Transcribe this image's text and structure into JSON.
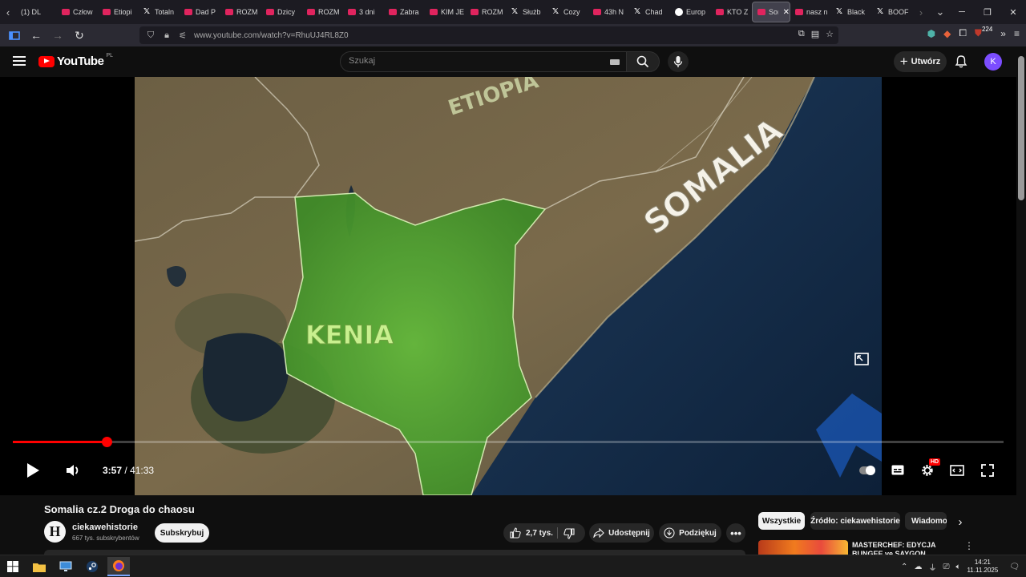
{
  "browser": {
    "tabs": [
      {
        "label": "(1) DL",
        "icon": "none"
      },
      {
        "label": "Człow",
        "icon": "youtube"
      },
      {
        "label": "Etiopi",
        "icon": "youtube"
      },
      {
        "label": "Totaln",
        "icon": "x"
      },
      {
        "label": "Dad P",
        "icon": "youtube"
      },
      {
        "label": "ROZM",
        "icon": "youtube"
      },
      {
        "label": "Dzicy",
        "icon": "youtube"
      },
      {
        "label": "ROZM",
        "icon": "youtube"
      },
      {
        "label": "3 dni",
        "icon": "youtube"
      },
      {
        "label": "Zabra",
        "icon": "youtube"
      },
      {
        "label": "KIM JE",
        "icon": "youtube"
      },
      {
        "label": "ROZM",
        "icon": "youtube"
      },
      {
        "label": "Służb",
        "icon": "x"
      },
      {
        "label": "Cozy",
        "icon": "x"
      },
      {
        "label": "43h N",
        "icon": "youtube"
      },
      {
        "label": "Chad",
        "icon": "x"
      },
      {
        "label": "Europ",
        "icon": "globe"
      },
      {
        "label": "KTO Z",
        "icon": "youtube"
      },
      {
        "label": "Son",
        "icon": "youtube",
        "active": true
      },
      {
        "label": "nasz n",
        "icon": "youtube"
      },
      {
        "label": "Black",
        "icon": "x"
      },
      {
        "label": "BOOF",
        "icon": "x"
      }
    ],
    "url": "www.youtube.com/watch?v=RhuUJ4RL8Z0",
    "ext_badge": "224"
  },
  "youtube": {
    "logo_text": "YouTube",
    "country": "PL",
    "search_placeholder": "Szukaj",
    "create_label": "Utwórz",
    "avatar_letter": "K"
  },
  "player": {
    "current_time": "3:57",
    "separator": "/",
    "duration": "41:33",
    "progress": 0.095,
    "hd_label": "HD",
    "map_labels": {
      "kenya": "KENIA",
      "somalia": "SOMALIA",
      "ethiopia": "ETIOPIA"
    }
  },
  "video": {
    "title": "Somalia cz.2 Droga do chaosu",
    "channel_letter": "H",
    "channel_name": "ciekawehistorie",
    "subscribers": "667 tys. subskrybentów",
    "subscribe_label": "Subskrybuj",
    "likes": "2,7 tys.",
    "share_label": "Udostępnij",
    "thanks_label": "Podziękuj"
  },
  "chips": [
    "Wszystkie",
    "Źródło: ciekawehistorie",
    "Wiadomości"
  ],
  "recommendation": {
    "title": "MASTERCHEF: EDYCJA BUNGEE ve SAYGON"
  },
  "taskbar": {
    "time": "14:21",
    "date": "11.11.2025"
  },
  "colors": {
    "accent_red": "#ff0000",
    "avatar_purple": "#7c4dff",
    "kenya_green": "#5fb53a"
  }
}
